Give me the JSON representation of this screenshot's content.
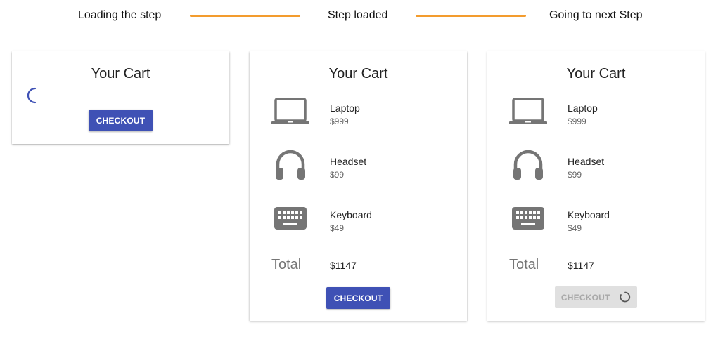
{
  "steps": {
    "step1_label": "Loading the step",
    "step2_label": "Step loaded",
    "step3_label": "Going to next Step"
  },
  "cards": {
    "card1": {
      "title": "Your Cart",
      "checkout_label": "CHECKOUT"
    },
    "card2": {
      "title": "Your Cart",
      "items": [
        {
          "name": "Laptop",
          "price": "$999",
          "icon": "laptop-icon"
        },
        {
          "name": "Headset",
          "price": "$99",
          "icon": "headset-icon"
        },
        {
          "name": "Keyboard",
          "price": "$49",
          "icon": "keyboard-icon"
        }
      ],
      "total_label": "Total",
      "total_value": "$1147",
      "checkout_label": "CHECKOUT"
    },
    "card3": {
      "title": "Your Cart",
      "items": [
        {
          "name": "Laptop",
          "price": "$999",
          "icon": "laptop-icon"
        },
        {
          "name": "Headset",
          "price": "$99",
          "icon": "headset-icon"
        },
        {
          "name": "Keyboard",
          "price": "$49",
          "icon": "keyboard-icon"
        }
      ],
      "total_label": "Total",
      "total_value": "$1147",
      "checkout_label": "CHECKOUT"
    }
  },
  "colors": {
    "primary": "#3f51b5",
    "connector": "#f39c2e",
    "icon": "#757575",
    "disabled_button_bg": "#e0e0e0",
    "baseline": "#bdbdbd"
  }
}
